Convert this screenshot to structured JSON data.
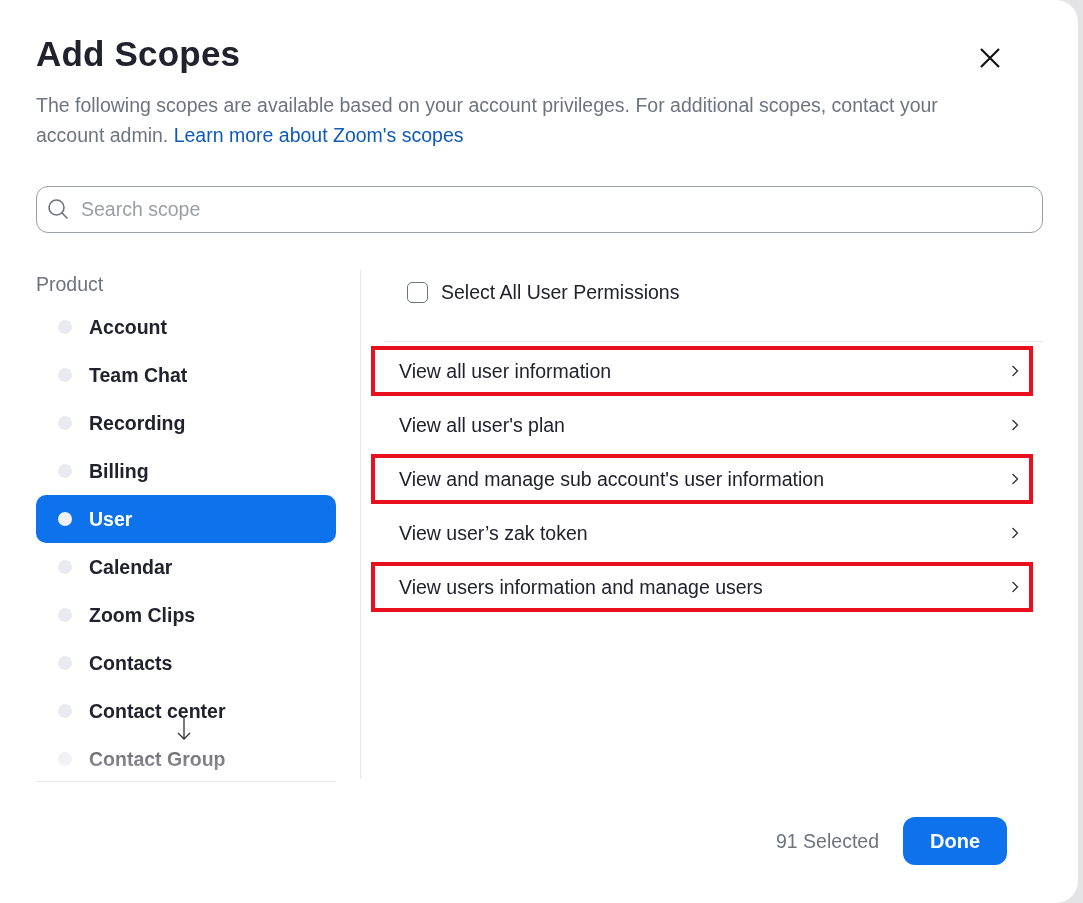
{
  "dialog": {
    "title": "Add Scopes",
    "description": "The following scopes are available based on your account privileges. For additional scopes, contact your account admin.",
    "link": "Learn more about Zoom's scopes"
  },
  "search": {
    "placeholder": "Search scope"
  },
  "products": {
    "heading": "Product",
    "items": [
      {
        "label": "Account",
        "selected": false
      },
      {
        "label": "Team Chat",
        "selected": false
      },
      {
        "label": "Recording",
        "selected": false
      },
      {
        "label": "Billing",
        "selected": false
      },
      {
        "label": "User",
        "selected": true
      },
      {
        "label": "Calendar",
        "selected": false
      },
      {
        "label": "Zoom Clips",
        "selected": false
      },
      {
        "label": "Contacts",
        "selected": false
      },
      {
        "label": "Contact center",
        "selected": false
      },
      {
        "label": "Contact Group",
        "selected": false
      }
    ]
  },
  "select_all": {
    "label": "Select All User Permissions",
    "checked": false
  },
  "scopes": [
    {
      "label": "View all user information",
      "highlighted": true
    },
    {
      "label": "View all user's plan",
      "highlighted": false
    },
    {
      "label": "View and manage sub account's user information",
      "highlighted": true
    },
    {
      "label": "View user’s zak token",
      "highlighted": false
    },
    {
      "label": "View users information and manage users",
      "highlighted": true
    }
  ],
  "footer": {
    "count": "91 Selected",
    "button": "Done"
  }
}
